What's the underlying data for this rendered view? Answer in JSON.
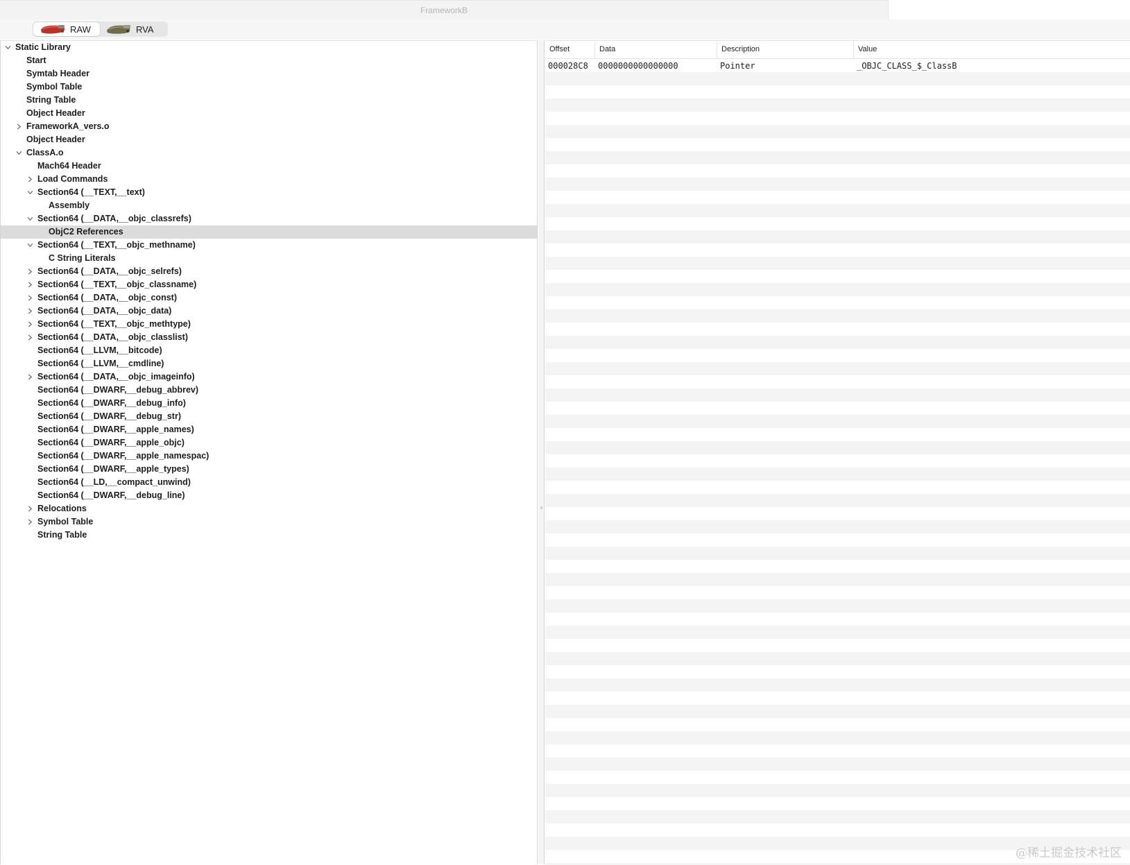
{
  "window": {
    "title": "FrameworkB"
  },
  "toolbar": {
    "segments": [
      {
        "label": "RAW",
        "icon": "raw-tool-icon",
        "active": true
      },
      {
        "label": "RVA",
        "icon": "rva-tool-icon",
        "active": false
      }
    ]
  },
  "tree": [
    {
      "label": "Static Library",
      "depth": 0,
      "disclosure": "expanded"
    },
    {
      "label": "Start",
      "depth": 1,
      "disclosure": "none"
    },
    {
      "label": "Symtab Header",
      "depth": 1,
      "disclosure": "none"
    },
    {
      "label": "Symbol Table",
      "depth": 1,
      "disclosure": "none"
    },
    {
      "label": "String Table",
      "depth": 1,
      "disclosure": "none"
    },
    {
      "label": "Object Header",
      "depth": 1,
      "disclosure": "none"
    },
    {
      "label": "FrameworkA_vers.o",
      "depth": 1,
      "disclosure": "collapsed"
    },
    {
      "label": "Object Header",
      "depth": 1,
      "disclosure": "none"
    },
    {
      "label": "ClassA.o",
      "depth": 1,
      "disclosure": "expanded"
    },
    {
      "label": "Mach64 Header",
      "depth": 2,
      "disclosure": "none"
    },
    {
      "label": "Load Commands",
      "depth": 2,
      "disclosure": "collapsed"
    },
    {
      "label": "Section64 (__TEXT,__text)",
      "depth": 2,
      "disclosure": "expanded"
    },
    {
      "label": "Assembly",
      "depth": 3,
      "disclosure": "none"
    },
    {
      "label": "Section64 (__DATA,__objc_classrefs)",
      "depth": 2,
      "disclosure": "expanded"
    },
    {
      "label": "ObjC2 References",
      "depth": 3,
      "disclosure": "none",
      "selected": true
    },
    {
      "label": "Section64 (__TEXT,__objc_methname)",
      "depth": 2,
      "disclosure": "expanded"
    },
    {
      "label": "C String Literals",
      "depth": 3,
      "disclosure": "none"
    },
    {
      "label": "Section64 (__DATA,__objc_selrefs)",
      "depth": 2,
      "disclosure": "collapsed"
    },
    {
      "label": "Section64 (__TEXT,__objc_classname)",
      "depth": 2,
      "disclosure": "collapsed"
    },
    {
      "label": "Section64 (__DATA,__objc_const)",
      "depth": 2,
      "disclosure": "collapsed"
    },
    {
      "label": "Section64 (__DATA,__objc_data)",
      "depth": 2,
      "disclosure": "collapsed"
    },
    {
      "label": "Section64 (__TEXT,__objc_methtype)",
      "depth": 2,
      "disclosure": "collapsed"
    },
    {
      "label": "Section64 (__DATA,__objc_classlist)",
      "depth": 2,
      "disclosure": "collapsed"
    },
    {
      "label": "Section64 (__LLVM,__bitcode)",
      "depth": 2,
      "disclosure": "none"
    },
    {
      "label": "Section64 (__LLVM,__cmdline)",
      "depth": 2,
      "disclosure": "none"
    },
    {
      "label": "Section64 (__DATA,__objc_imageinfo)",
      "depth": 2,
      "disclosure": "collapsed"
    },
    {
      "label": "Section64 (__DWARF,__debug_abbrev)",
      "depth": 2,
      "disclosure": "none"
    },
    {
      "label": "Section64 (__DWARF,__debug_info)",
      "depth": 2,
      "disclosure": "none"
    },
    {
      "label": "Section64 (__DWARF,__debug_str)",
      "depth": 2,
      "disclosure": "none"
    },
    {
      "label": "Section64 (__DWARF,__apple_names)",
      "depth": 2,
      "disclosure": "none"
    },
    {
      "label": "Section64 (__DWARF,__apple_objc)",
      "depth": 2,
      "disclosure": "none"
    },
    {
      "label": "Section64 (__DWARF,__apple_namespac)",
      "depth": 2,
      "disclosure": "none"
    },
    {
      "label": "Section64 (__DWARF,__apple_types)",
      "depth": 2,
      "disclosure": "none"
    },
    {
      "label": "Section64 (__LD,__compact_unwind)",
      "depth": 2,
      "disclosure": "none"
    },
    {
      "label": "Section64 (__DWARF,__debug_line)",
      "depth": 2,
      "disclosure": "none"
    },
    {
      "label": "Relocations",
      "depth": 2,
      "disclosure": "collapsed"
    },
    {
      "label": "Symbol Table",
      "depth": 2,
      "disclosure": "collapsed"
    },
    {
      "label": "String Table",
      "depth": 2,
      "disclosure": "none"
    }
  ],
  "table": {
    "columns": [
      "Offset",
      "Data",
      "Description",
      "Value"
    ],
    "rows": [
      [
        "000028C8",
        "0000000000000000",
        "Pointer",
        "_OBJC_CLASS_$_ClassB"
      ]
    ]
  },
  "watermark": "@稀土掘金技术社区"
}
